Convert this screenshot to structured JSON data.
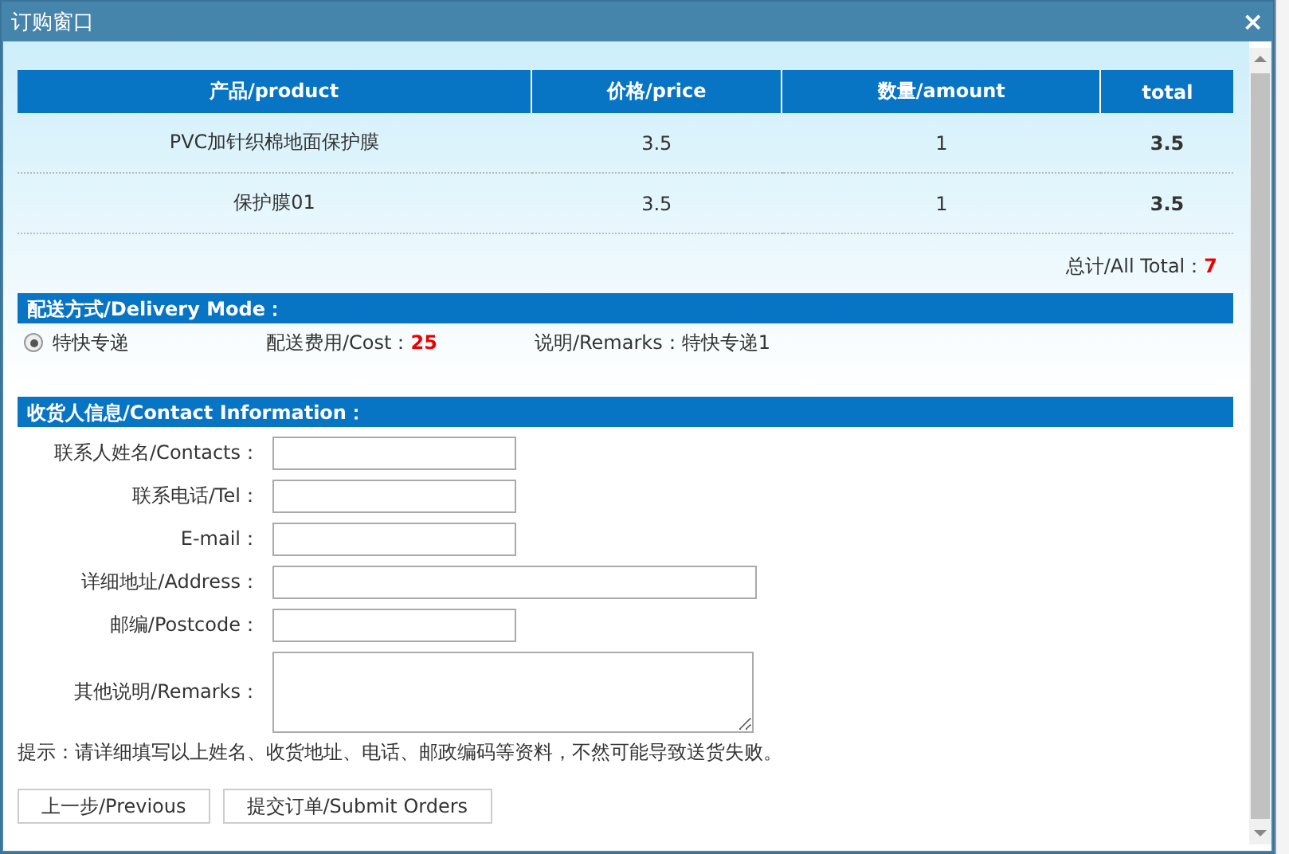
{
  "window": {
    "title": "订购窗口",
    "close": "×"
  },
  "table": {
    "columns": [
      "产品/product",
      "价格/price",
      "数量/amount",
      "total"
    ],
    "rows": [
      [
        "PVC加针织棉地面保护膜",
        "3.5",
        "1",
        "3.5"
      ],
      [
        "保护膜01",
        "3.5",
        "1",
        "3.5"
      ]
    ]
  },
  "all_total": {
    "label": "总计/All Total：",
    "value": "7"
  },
  "delivery": {
    "heading": "配送方式/Delivery Mode：",
    "options": [
      {
        "label": "特快专递",
        "selected": true,
        "cost_label": "配送费用/Cost：",
        "cost": "25",
        "remarks": "说明/Remarks：特快专递1"
      }
    ]
  },
  "contact": {
    "heading": "收货人信息/Contact Information：",
    "fields": [
      {
        "label": "联系人姓名/Contacts：",
        "kind": "short"
      },
      {
        "label": "联系电话/Tel：",
        "kind": "short"
      },
      {
        "label": "E-mail：",
        "kind": "short"
      },
      {
        "label": "详细地址/Address：",
        "kind": "long"
      },
      {
        "label": "邮编/Postcode：",
        "kind": "short"
      },
      {
        "label": "其他说明/Remarks：",
        "kind": "textarea"
      }
    ]
  },
  "hint": "提示：请详细填写以上姓名、收货地址、电话、邮政编码等资料，不然可能导致送货失败。",
  "buttons": [
    "上一步/Previous",
    "提交订单/Submit Orders"
  ]
}
